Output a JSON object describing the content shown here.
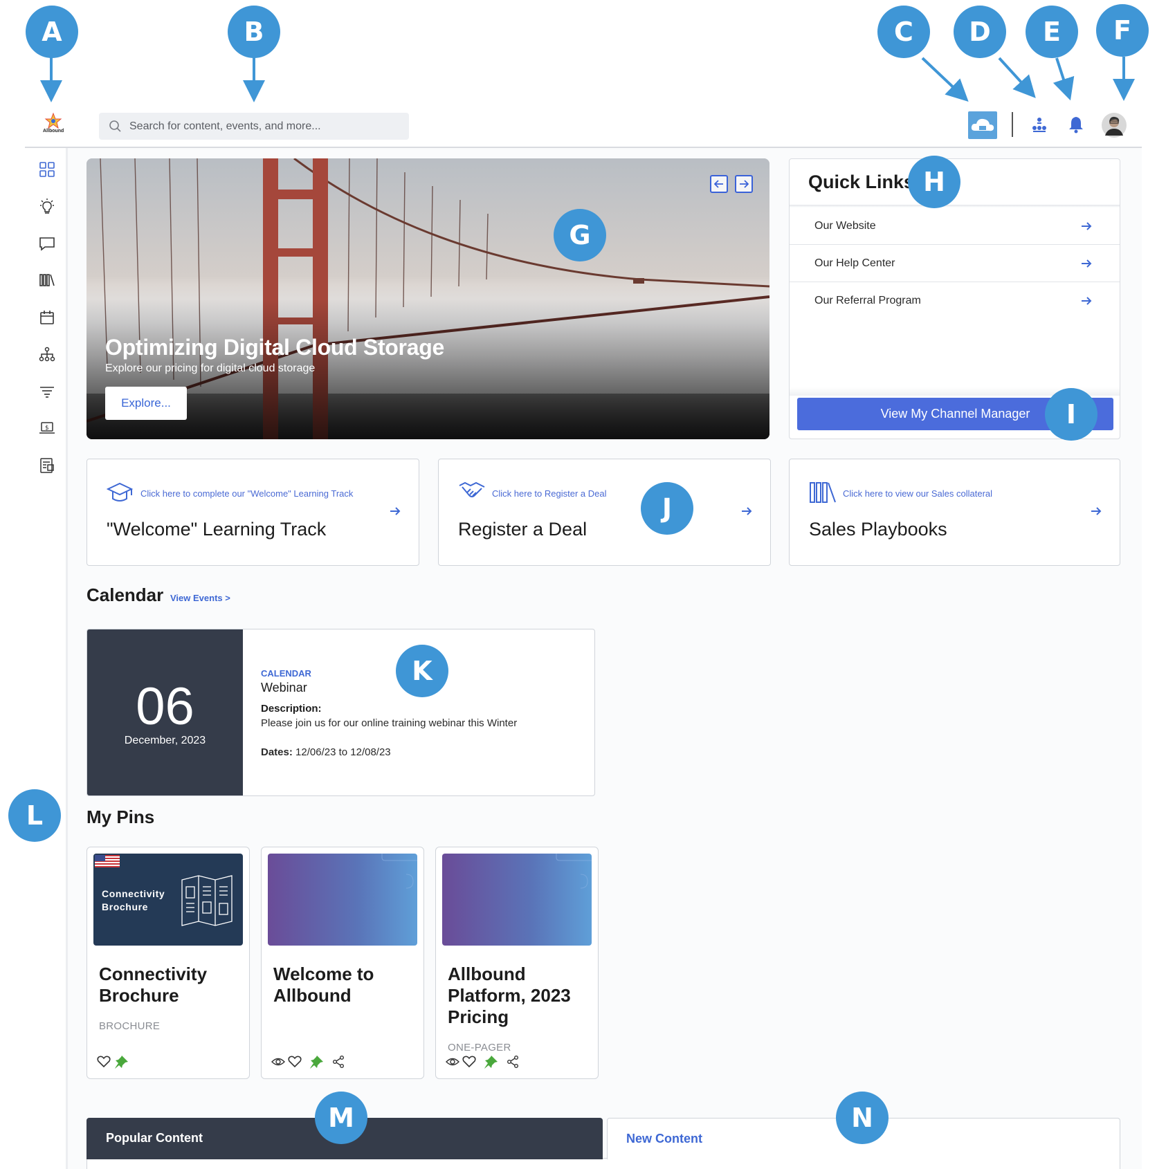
{
  "callouts": {
    "a": "A",
    "b": "B",
    "c": "C",
    "d": "D",
    "e": "E",
    "f": "F",
    "g": "G",
    "h": "H",
    "i": "I",
    "j": "J",
    "k": "K",
    "l": "L",
    "m": "M",
    "n": "N"
  },
  "header": {
    "logo_text": "Allbound",
    "search_placeholder": "Search for content, events, and more...",
    "icons": [
      "cloud-icon",
      "org-chart-icon",
      "bell-icon",
      "user-avatar"
    ]
  },
  "sidebar": {
    "icons": [
      "dashboard-icon",
      "lightbulb-icon",
      "chat-icon",
      "library-icon",
      "calendar-icon",
      "hierarchy-icon",
      "filter-icon",
      "laptop-dollar-icon",
      "news-icon"
    ]
  },
  "hero": {
    "title": "Optimizing Digital Cloud Storage",
    "subtitle": "Explore our pricing for digital cloud storage",
    "button_label": "Explore..."
  },
  "quick_links": {
    "title": "Quick Links",
    "links": [
      "Our Website",
      "Our Help Center",
      "Our Referral Program"
    ],
    "button_label": "View My Channel Manager"
  },
  "cards": [
    {
      "hint": "Click here to complete our \"Welcome\" Learning Track",
      "title": "\"Welcome\" Learning Track",
      "icon": "graduation-cap-icon"
    },
    {
      "hint": "Click here to Register a Deal",
      "title": "Register a Deal",
      "icon": "handshake-icon"
    },
    {
      "hint": "Click here to view our Sales collateral",
      "title": "Sales Playbooks",
      "icon": "books-icon"
    }
  ],
  "calendar": {
    "heading": "Calendar",
    "view_link": "View Events >",
    "event": {
      "day": "06",
      "month_year": "December, 2023",
      "tag": "CALENDAR",
      "name": "Webinar",
      "description_label": "Description:",
      "description": "Please join us for our online training webinar this Winter",
      "dates_label": "Dates:",
      "dates": "12/06/23 to 12/08/23"
    }
  },
  "pins": {
    "heading": "My Pins",
    "items": [
      {
        "thumb_text_1": "Connectivity",
        "thumb_text_2": "Brochure",
        "title": "Connectivity Brochure",
        "type": "BROCHURE"
      },
      {
        "title": "Welcome to Allbound",
        "type": ""
      },
      {
        "title": "Allbound Platform, 2023 Pricing",
        "type": "ONE-PAGER"
      }
    ]
  },
  "content_tabs": {
    "popular": "Popular Content",
    "new": "New Content"
  },
  "colors": {
    "accent_blue": "#4b6cdc",
    "callout_blue": "#3f96d6",
    "dark_panel": "#353c4a",
    "pin_green": "#4aa83c"
  }
}
